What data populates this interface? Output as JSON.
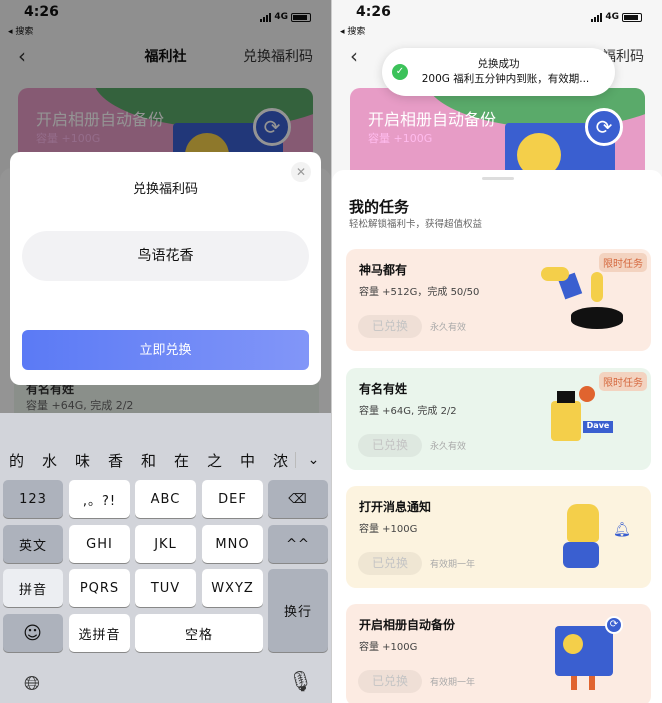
{
  "status": {
    "time": "4:26",
    "back_app": "◂ 搜索",
    "network": "4G"
  },
  "left": {
    "nav": {
      "title": "福利社",
      "right": "兑换福利码"
    },
    "banner": {
      "title": "开启相册自动备份",
      "subtitle": "容量 +100G"
    },
    "behind_card": {
      "title": "有名有姓",
      "desc": "容量 +64G, 完成 2/2"
    },
    "modal": {
      "title": "兑换福利码",
      "code": "鸟语花香",
      "button": "立即兑换"
    },
    "keyboard": {
      "candidates": [
        "的",
        "水",
        "味",
        "香",
        "和",
        "在",
        "之",
        "中",
        "浓"
      ],
      "keys": [
        "123",
        ",。?!",
        "ABC",
        "DEF",
        "英文",
        "GHI",
        "JKL",
        "MNO",
        "^^",
        "拼音",
        "PQRS",
        "TUV",
        "WXYZ",
        "选拼音",
        "空格",
        "换行"
      ]
    }
  },
  "right": {
    "nav": {
      "right": "兑换福利码"
    },
    "toast": {
      "title": "兑换成功",
      "message": "200G 福利五分钟内到账，有效期..."
    },
    "banner": {
      "title": "开启相册自动备份",
      "subtitle": "容量 +100G"
    },
    "sheet": {
      "title": "我的任务",
      "subtitle": "轻松解锁福利卡，获得超值权益"
    },
    "tasks": [
      {
        "name": "神马都有",
        "desc": "容量 +512G，完成 50/50",
        "button": "已兑换",
        "validity": "永久有效",
        "badge": "限时任务",
        "bg": "#fcebe2"
      },
      {
        "name": "有名有姓",
        "desc": "容量 +64G, 完成 2/2",
        "button": "已兑换",
        "validity": "永久有效",
        "badge": "限时任务",
        "bg": "#eaf5ec"
      },
      {
        "name": "打开消息通知",
        "desc": "容量 +100G",
        "button": "已兑换",
        "validity": "有效期一年",
        "bg": "#fcf3df"
      },
      {
        "name": "开启相册自动备份",
        "desc": "容量 +100G",
        "button": "已兑换",
        "validity": "有效期一年",
        "bg": "#fcebe2"
      }
    ]
  }
}
